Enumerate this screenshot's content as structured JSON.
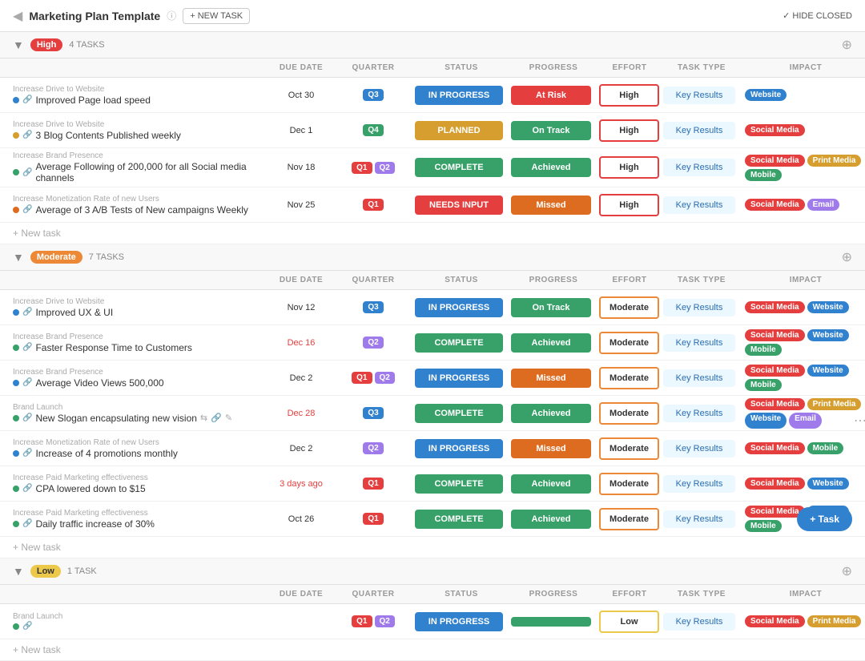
{
  "header": {
    "title": "Marketing Plan Template",
    "new_task_label": "+ NEW TASK",
    "hide_closed_label": "✓ HIDE CLOSED"
  },
  "columns": [
    "",
    "DUE DATE",
    "QUARTER",
    "STATUS",
    "PROGRESS",
    "EFFORT",
    "TASK TYPE",
    "IMPACT"
  ],
  "sections": [
    {
      "id": "high",
      "priority": "High",
      "priority_class": "priority-high",
      "task_count": "4 TASKS",
      "tasks": [
        {
          "parent": "Increase Drive to Website",
          "name": "Improved Page load speed",
          "dot": "dot-blue",
          "due_date": "Oct 30",
          "due_class": "normal",
          "quarters": [
            {
              "label": "Q3",
              "class": "q3"
            }
          ],
          "status": "IN PROGRESS",
          "status_class": "status-inprogress",
          "progress": "At Risk",
          "progress_class": "prog-atrisk",
          "effort": "High",
          "effort_class": "",
          "task_type": "Key Results",
          "impact": [
            {
              "label": "Website",
              "class": "tag-website"
            }
          ]
        },
        {
          "parent": "Increase Drive to Website",
          "name": "3 Blog Contents Published weekly",
          "dot": "dot-yellow",
          "due_date": "Dec 1",
          "due_class": "normal",
          "quarters": [
            {
              "label": "Q4",
              "class": "q4"
            }
          ],
          "status": "PLANNED",
          "status_class": "status-planned",
          "progress": "On Track",
          "progress_class": "prog-ontrack",
          "effort": "High",
          "effort_class": "",
          "task_type": "Key Results",
          "impact": [
            {
              "label": "Social Media",
              "class": "tag-social"
            }
          ]
        },
        {
          "parent": "Increase Brand Presence",
          "name": "Average Following of 200,000 for all Social media channels",
          "dot": "dot-green",
          "due_date": "Nov 18",
          "due_class": "normal",
          "quarters": [
            {
              "label": "Q1",
              "class": "q1"
            },
            {
              "label": "Q2",
              "class": "q2"
            }
          ],
          "status": "COMPLETE",
          "status_class": "status-complete",
          "progress": "Achieved",
          "progress_class": "prog-achieved",
          "effort": "High",
          "effort_class": "",
          "task_type": "Key Results",
          "impact": [
            {
              "label": "Social Media",
              "class": "tag-social"
            },
            {
              "label": "Print Media",
              "class": "tag-print"
            },
            {
              "label": "Mobile",
              "class": "tag-mobile"
            }
          ]
        },
        {
          "parent": "Increase Monetization Rate of new Users",
          "name": "Average of 3 A/B Tests of New campaigns Weekly",
          "dot": "dot-orange",
          "due_date": "Nov 25",
          "due_class": "normal",
          "quarters": [
            {
              "label": "Q1",
              "class": "q1"
            }
          ],
          "status": "NEEDS INPUT",
          "status_class": "status-needsinput",
          "progress": "Missed",
          "progress_class": "prog-missed",
          "effort": "High",
          "effort_class": "",
          "task_type": "Key Results",
          "impact": [
            {
              "label": "Social Media",
              "class": "tag-social"
            },
            {
              "label": "Email",
              "class": "tag-email"
            }
          ]
        }
      ]
    },
    {
      "id": "moderate",
      "priority": "Moderate",
      "priority_class": "priority-moderate",
      "task_count": "7 TASKS",
      "tasks": [
        {
          "parent": "Increase Drive to Website",
          "name": "Improved UX & UI",
          "dot": "dot-blue",
          "due_date": "Nov 12",
          "due_class": "normal",
          "quarters": [
            {
              "label": "Q3",
              "class": "q3"
            }
          ],
          "status": "IN PROGRESS",
          "status_class": "status-inprogress",
          "progress": "On Track",
          "progress_class": "prog-ontrack",
          "effort": "Moderate",
          "effort_class": "effort-moderate",
          "task_type": "Key Results",
          "impact": [
            {
              "label": "Social Media",
              "class": "tag-social"
            },
            {
              "label": "Website",
              "class": "tag-website"
            }
          ]
        },
        {
          "parent": "Increase Brand Presence",
          "name": "Faster Response Time to Customers",
          "dot": "dot-green",
          "due_date": "Dec 16",
          "due_class": "overdue",
          "quarters": [
            {
              "label": "Q2",
              "class": "q2"
            }
          ],
          "status": "COMPLETE",
          "status_class": "status-complete",
          "progress": "Achieved",
          "progress_class": "prog-achieved",
          "effort": "Moderate",
          "effort_class": "effort-moderate",
          "task_type": "Key Results",
          "impact": [
            {
              "label": "Social Media",
              "class": "tag-social"
            },
            {
              "label": "Website",
              "class": "tag-website"
            },
            {
              "label": "Mobile",
              "class": "tag-mobile"
            }
          ]
        },
        {
          "parent": "Increase Brand Presence",
          "name": "Average Video Views 500,000",
          "dot": "dot-blue",
          "due_date": "Dec 2",
          "due_class": "normal",
          "quarters": [
            {
              "label": "Q1",
              "class": "q1"
            },
            {
              "label": "Q2",
              "class": "q2"
            }
          ],
          "status": "IN PROGRESS",
          "status_class": "status-inprogress",
          "progress": "Missed",
          "progress_class": "prog-missed",
          "effort": "Moderate",
          "effort_class": "effort-moderate",
          "task_type": "Key Results",
          "impact": [
            {
              "label": "Social Media",
              "class": "tag-social"
            },
            {
              "label": "Website",
              "class": "tag-website"
            },
            {
              "label": "Mobile",
              "class": "tag-mobile"
            }
          ]
        },
        {
          "parent": "Brand Launch",
          "name": "New Slogan encapsulating new vision",
          "dot": "dot-green",
          "due_date": "Dec 28",
          "due_class": "overdue",
          "quarters": [
            {
              "label": "Q3",
              "class": "q3"
            }
          ],
          "status": "COMPLETE",
          "status_class": "status-complete",
          "progress": "Achieved",
          "progress_class": "prog-achieved",
          "effort": "Moderate",
          "effort_class": "effort-moderate",
          "task_type": "Key Results",
          "impact": [
            {
              "label": "Social Media",
              "class": "tag-social"
            },
            {
              "label": "Print Media",
              "class": "tag-print"
            },
            {
              "label": "Website",
              "class": "tag-website"
            },
            {
              "label": "Email",
              "class": "tag-email"
            }
          ],
          "has_actions": true
        },
        {
          "parent": "Increase Monetization Rate of new Users",
          "name": "Increase of 4 promotions monthly",
          "dot": "dot-blue",
          "due_date": "Dec 2",
          "due_class": "normal",
          "quarters": [
            {
              "label": "Q2",
              "class": "q2"
            }
          ],
          "status": "IN PROGRESS",
          "status_class": "status-inprogress",
          "progress": "Missed",
          "progress_class": "prog-missed",
          "effort": "Moderate",
          "effort_class": "effort-moderate",
          "task_type": "Key Results",
          "impact": [
            {
              "label": "Social Media",
              "class": "tag-social"
            },
            {
              "label": "Mobile",
              "class": "tag-mobile"
            }
          ]
        },
        {
          "parent": "Increase Paid Marketing effectiveness",
          "name": "CPA lowered down to $15",
          "dot": "dot-green",
          "due_date": "3 days ago",
          "due_class": "overdue",
          "quarters": [
            {
              "label": "Q1",
              "class": "q1"
            }
          ],
          "status": "COMPLETE",
          "status_class": "status-complete",
          "progress": "Achieved",
          "progress_class": "prog-achieved",
          "effort": "Moderate",
          "effort_class": "effort-moderate",
          "task_type": "Key Results",
          "impact": [
            {
              "label": "Social Media",
              "class": "tag-social"
            },
            {
              "label": "Website",
              "class": "tag-website"
            }
          ]
        },
        {
          "parent": "Increase Paid Marketing effectiveness",
          "name": "Daily traffic increase of 30%",
          "dot": "dot-green",
          "due_date": "Oct 26",
          "due_class": "normal",
          "quarters": [
            {
              "label": "Q1",
              "class": "q1"
            }
          ],
          "status": "COMPLETE",
          "status_class": "status-complete",
          "progress": "Achieved",
          "progress_class": "prog-achieved",
          "effort": "Moderate",
          "effort_class": "effort-moderate",
          "task_type": "Key Results",
          "impact": [
            {
              "label": "Social Media",
              "class": "tag-social"
            },
            {
              "label": "Website",
              "class": "tag-website"
            },
            {
              "label": "Mobile",
              "class": "tag-mobile"
            }
          ]
        }
      ]
    },
    {
      "id": "low",
      "priority": "Low",
      "priority_class": "priority-low",
      "task_count": "1 TASK",
      "tasks": [
        {
          "parent": "Brand Launch",
          "name": "",
          "dot": "dot-green",
          "due_date": "",
          "due_class": "normal",
          "quarters": [
            {
              "label": "Q1",
              "class": "q1"
            },
            {
              "label": "Q2",
              "class": "q2"
            }
          ],
          "status": "IN PROGRESS",
          "status_class": "status-inprogress",
          "progress": "",
          "progress_class": "prog-ontrack",
          "effort": "Low",
          "effort_class": "effort-low",
          "task_type": "Key Results",
          "impact": [
            {
              "label": "Social Media",
              "class": "tag-social"
            },
            {
              "label": "Print Media",
              "class": "tag-print"
            }
          ]
        }
      ]
    }
  ],
  "fab_label": "+ Task"
}
